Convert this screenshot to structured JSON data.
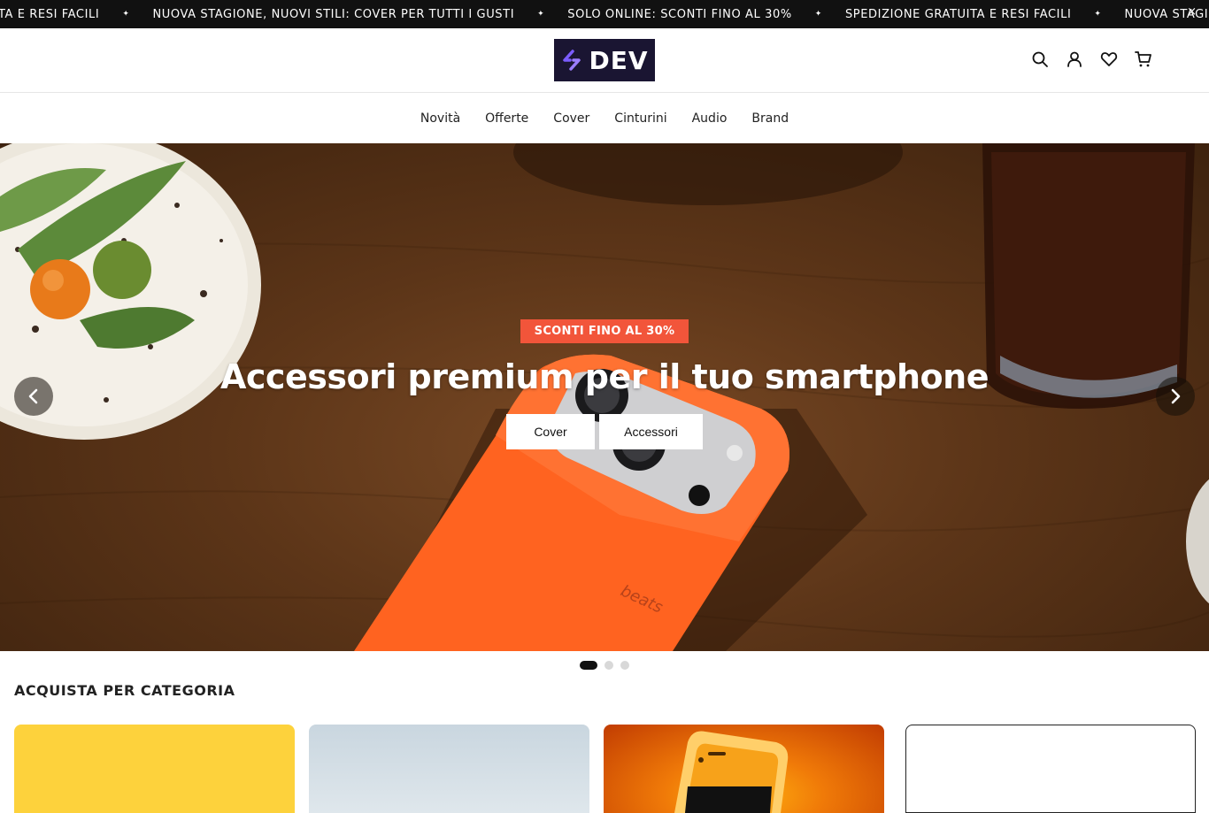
{
  "announcement": {
    "messages": [
      "TA E RESI FACILI",
      "NUOVA STAGIONE, NUOVI STILI: COVER PER TUTTI I GUSTI",
      "SOLO ONLINE: SCONTI FINO AL 30%",
      "SPEDIZIONE GRATUITA E RESI FACILI",
      "NUOVA STAGIONE, NUOVI STILI: COVER PER TUTTI I GUSTI"
    ],
    "separator": "✦",
    "close": "×"
  },
  "header": {
    "logo_text": "DEV",
    "icons": [
      "search-icon",
      "account-icon",
      "wishlist-icon",
      "cart-icon"
    ]
  },
  "nav": {
    "items": [
      "Novità",
      "Offerte",
      "Cover",
      "Cinturini",
      "Audio",
      "Brand"
    ]
  },
  "hero": {
    "badge": "SCONTI FINO AL 30%",
    "title": "Accessori premium per il tuo smartphone",
    "buttons": [
      "Cover",
      "Accessori"
    ],
    "prev": "‹",
    "next": "›",
    "slides_total": 3,
    "active_slide": 1
  },
  "categories": {
    "title": "ACQUISTA PER CATEGORIA"
  },
  "colors": {
    "announce_bg": "#111111",
    "logo_bg": "#1a1532",
    "badge_bg": "#f2553a"
  }
}
